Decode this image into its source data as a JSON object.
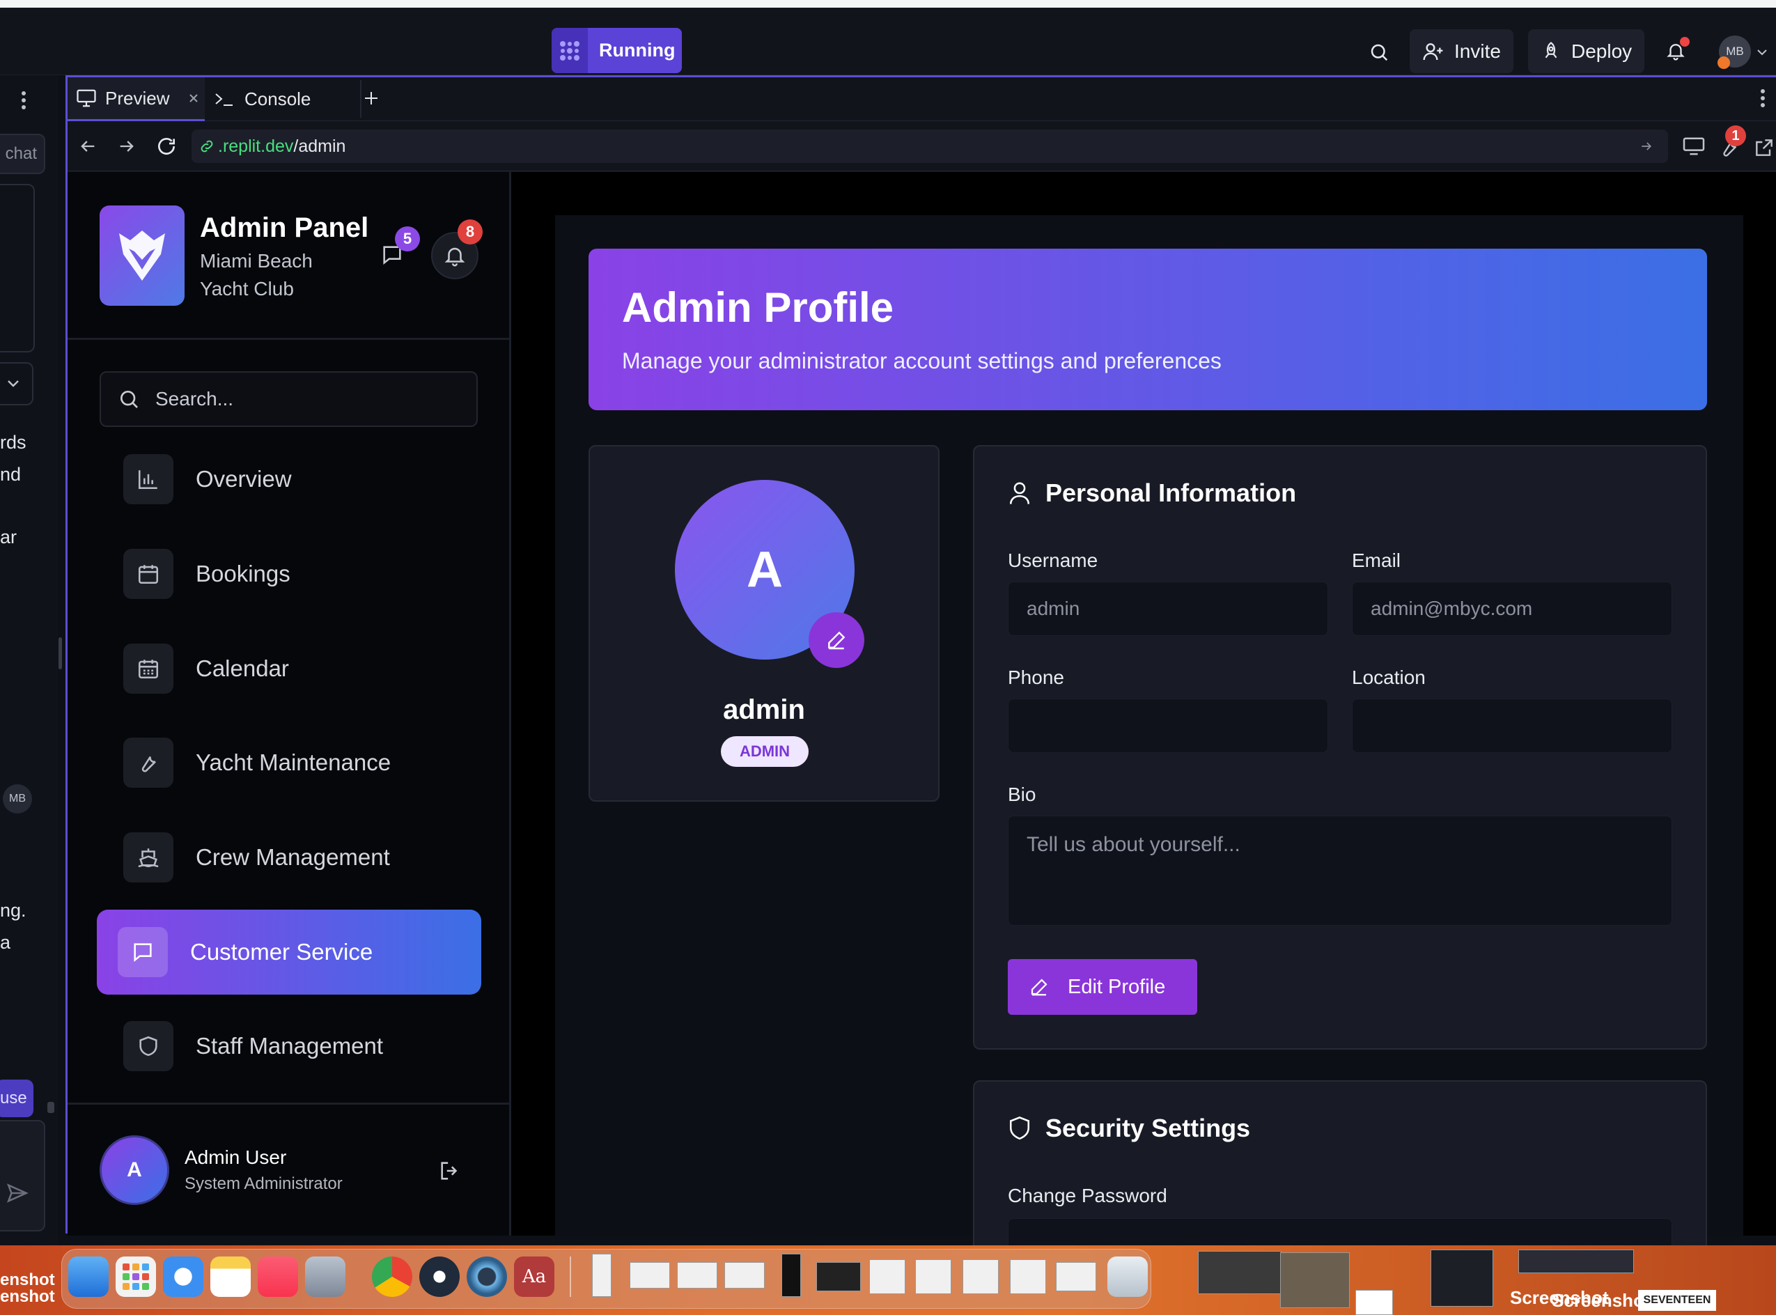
{
  "topbar": {
    "run_label": "Running",
    "invite_label": "Invite",
    "deploy_label": "Deploy",
    "avatar_initials": "MB"
  },
  "rail": {
    "chat_label": "chat",
    "text_1": "rds",
    "text_2": "nd",
    "text_3": "ar",
    "avatar_initials": "MB",
    "text_4": "ng.",
    "text_5": "a",
    "use_label": "use"
  },
  "tabs": [
    {
      "label": "Preview"
    },
    {
      "label": "Console"
    }
  ],
  "url": {
    "domain": ".replit.dev",
    "path": "/admin",
    "devtools_badge": "1"
  },
  "sidebar": {
    "title": "Admin Panel",
    "subtitle": "Miami Beach Yacht Club",
    "messages_count": "5",
    "notifications_count": "8",
    "search_placeholder": "Search...",
    "items": [
      {
        "label": "Overview"
      },
      {
        "label": "Bookings"
      },
      {
        "label": "Calendar"
      },
      {
        "label": "Yacht Maintenance"
      },
      {
        "label": "Crew Management"
      },
      {
        "label": "Customer Service"
      },
      {
        "label": "Staff Management"
      }
    ],
    "user": {
      "initial": "A",
      "name": "Admin User",
      "role": "System Administrator"
    }
  },
  "main": {
    "hero_title": "Admin Profile",
    "hero_subtitle": "Manage your administrator account settings and preferences",
    "profile": {
      "initial": "A",
      "name": "admin",
      "role_badge": "ADMIN"
    },
    "personal": {
      "title": "Personal Information",
      "username_label": "Username",
      "username_value": "admin",
      "email_label": "Email",
      "email_value": "admin@mbyc.com",
      "phone_label": "Phone",
      "phone_value": "",
      "location_label": "Location",
      "location_value": "",
      "bio_label": "Bio",
      "bio_placeholder": "Tell us about yourself...",
      "edit_button": "Edit Profile"
    },
    "security": {
      "title": "Security Settings",
      "change_password_label": "Change Password"
    }
  },
  "dock": {
    "label_1": "enshot",
    "label_2": "enshot",
    "label_3": "Screenshot",
    "label_4": "Screenshot",
    "label_5": "SEVENTEEN"
  },
  "colors": {
    "accent": "#5b4ed3",
    "gradient_start": "#8a42e6",
    "gradient_end": "#3b6fe6",
    "badge_purple": "#8b4ae6",
    "badge_red": "#e0413d"
  }
}
